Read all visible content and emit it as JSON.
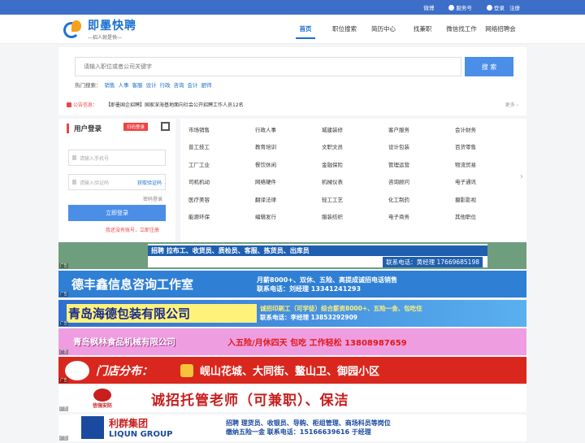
{
  "topbar": {
    "weibo": "微博",
    "service": "服务号",
    "login": "登录",
    "register": "注册"
  },
  "logo": {
    "name": "即墨快聘",
    "slogan": "—招人就是快—"
  },
  "nav": [
    {
      "label": "首页",
      "active": true
    },
    {
      "label": "职位搜索"
    },
    {
      "label": "简历中心"
    },
    {
      "label": "找兼职"
    },
    {
      "label": "微信找工作"
    },
    {
      "label": "网络招聘会"
    }
  ],
  "search": {
    "placeholder": "请输入职位或者公司关键字",
    "button": "搜 索",
    "hot_label": "热门搜索：",
    "hot": [
      "销售",
      "人事",
      "客服",
      "设计",
      "行政",
      "咨询",
      "会计",
      "厨师"
    ]
  },
  "notice": {
    "label": "公告信息：",
    "text": "【即墨国企招聘】国家深海基地面向社会公开招聘工作人员12名",
    "more": "更多 ›"
  },
  "login": {
    "title": "用户登录",
    "tag": "扫码登录",
    "phone_placeholder": "请输入手机号",
    "code_placeholder": "请输入验证码",
    "get_code": "获取验证码",
    "pwd_login": "密码登录",
    "button": "立即登录",
    "register": "我还没有账号，立即注册"
  },
  "categories": [
    "市场销售",
    "行政人事",
    "城建装修",
    "客户服务",
    "会计财务",
    "普工技工",
    "教育培训",
    "文职文员",
    "设计包装",
    "百货零售",
    "工厂工业",
    "餐饮休闲",
    "金融保险",
    "管理运营",
    "物流贸易",
    "司机机动",
    "网络硬件",
    "机械仪表",
    "咨询顾问",
    "电子通讯",
    "医疗美容",
    "翻译法律",
    "轻工工艺",
    "化工制药",
    "摄影影视",
    "能源环保",
    "编辑发行",
    "服装纺织",
    "电子商务",
    "其他职位"
  ],
  "ads": {
    "tag": "广告",
    "a1": {
      "line1": "招聘 拉布工、收货员、质检员、客服、拣货员、出库员",
      "line2": "联系电话：黄经理 17669685198"
    },
    "a2": {
      "name": "德丰鑫信息咨询工作室",
      "line1": "月薪8000+、双休、五险、高提成诚招电话销售",
      "line2": "联系电话：刘经理 13341241293"
    },
    "a3": {
      "name": "青岛海德包装有限公司",
      "line1": "诚招印刷工（可学徒）综合薪资8000+、五险一金、包吃住",
      "line2": "联系电话：李经理 13853292909"
    },
    "a4": {
      "name": "青岛枫林食品机械有限公司",
      "line1": "入五险/月休四天 包吃 工作轻松 13808987659"
    },
    "a5": {
      "name": "门店分布：",
      "line1": "岘山花城、大同街、鳌山卫、御园小区"
    },
    "a6": {
      "logo": "信强安防",
      "line1": "诚招托管老师（可兼职）、保洁"
    },
    "a7": {
      "cn": "利群集团",
      "en": "LIQUN GROUP",
      "line1": "招聘 理货员、收银员、导购、柜组管理、商场科员等岗位",
      "line2": "缴纳五险一金  联系电话：15166639616 于经理"
    }
  }
}
